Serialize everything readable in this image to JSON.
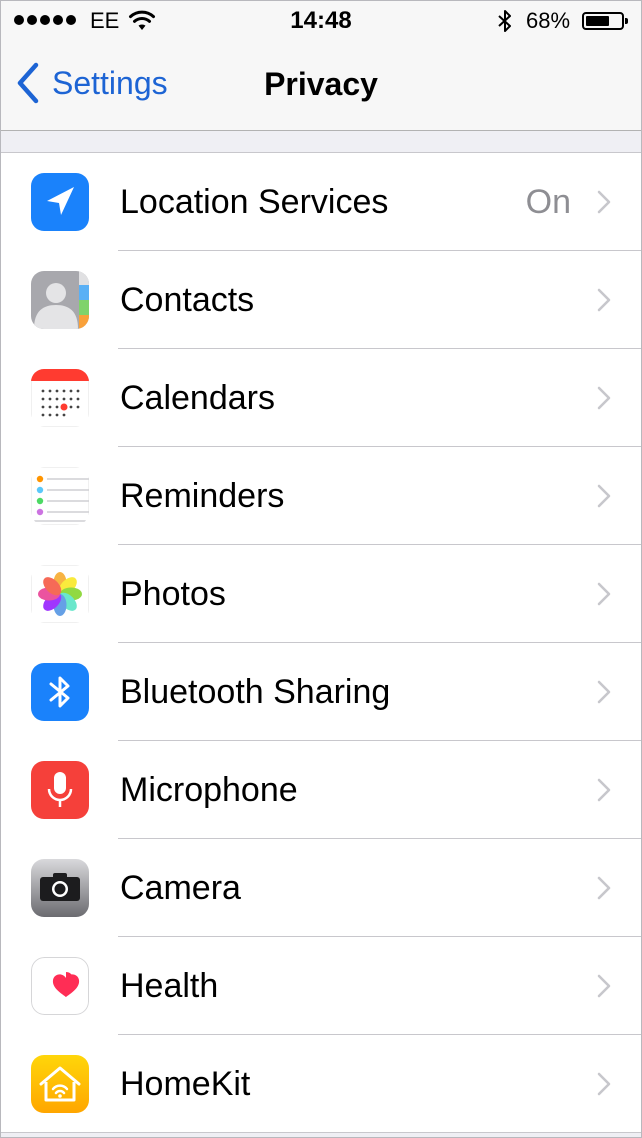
{
  "status_bar": {
    "carrier": "EE",
    "time": "14:48",
    "battery_percent": "68%",
    "battery_level": 0.68,
    "icons": [
      "signal-dots",
      "wifi-icon",
      "bluetooth-icon",
      "battery-icon"
    ]
  },
  "nav": {
    "back_label": "Settings",
    "title": "Privacy"
  },
  "rows": [
    {
      "label": "Location Services",
      "value": "On",
      "icon": "location-arrow-icon",
      "color": "#1a82fb"
    },
    {
      "label": "Contacts",
      "value": "",
      "icon": "contacts-icon",
      "color": "#8e8e93"
    },
    {
      "label": "Calendars",
      "value": "",
      "icon": "calendar-icon",
      "color": "#ff3b30"
    },
    {
      "label": "Reminders",
      "value": "",
      "icon": "reminders-icon",
      "color": "#ffffff"
    },
    {
      "label": "Photos",
      "value": "",
      "icon": "photos-icon",
      "color": "#ffffff"
    },
    {
      "label": "Bluetooth Sharing",
      "value": "",
      "icon": "bluetooth-icon",
      "color": "#1a82fb"
    },
    {
      "label": "Microphone",
      "value": "",
      "icon": "microphone-icon",
      "color": "#f5403a"
    },
    {
      "label": "Camera",
      "value": "",
      "icon": "camera-icon",
      "color": "#8e8e93"
    },
    {
      "label": "Health",
      "value": "",
      "icon": "heart-icon",
      "color": "#ff2d55"
    },
    {
      "label": "HomeKit",
      "value": "",
      "icon": "home-icon",
      "color": "#ffbe00"
    }
  ]
}
